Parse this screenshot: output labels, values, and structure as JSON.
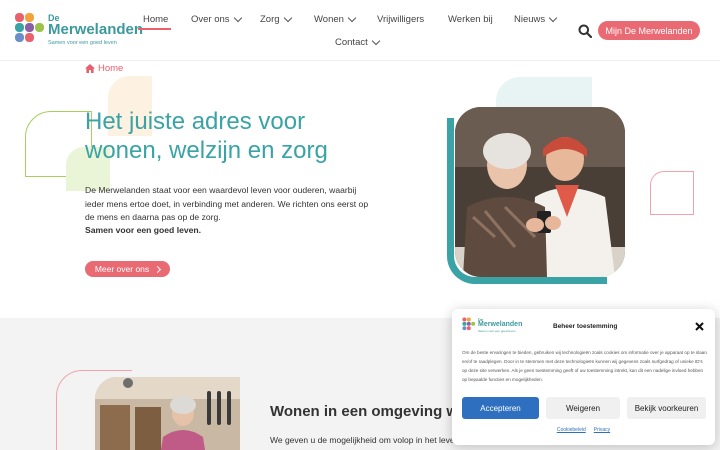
{
  "brand": {
    "name_line1": "De",
    "name_line2": "Merwelanden",
    "tagline": "Samen voor een goed leven"
  },
  "nav": {
    "items": [
      {
        "label": "Home",
        "active": true
      },
      {
        "label": "Over ons",
        "dropdown": true
      },
      {
        "label": "Zorg",
        "dropdown": true
      },
      {
        "label": "Wonen",
        "dropdown": true
      },
      {
        "label": "Vrijwilligers"
      },
      {
        "label": "Werken bij"
      },
      {
        "label": "Nieuws",
        "dropdown": true
      },
      {
        "label": "Contact",
        "dropdown": true
      }
    ],
    "cta_label": "Mijn De Merwelanden"
  },
  "hero": {
    "breadcrumb": "Home",
    "title": "Het juiste adres voor wonen, welzijn en zorg",
    "text": "De Merwelanden staat voor een waardevol leven voor ouderen, waarbij ieder mens ertoe doet, in verbinding met anderen. We richten ons eerst op de mens en daarna pas op de zorg.",
    "bold_text": "Samen voor een goed leven.",
    "button_label": "Meer over ons"
  },
  "section2": {
    "title": "Wonen in een omgeving wa",
    "text": "We geven u de mogelijkheid om volop in het leve"
  },
  "cookie": {
    "title": "Beheer toestemming",
    "body": "Om de beste ervaringen te bieden, gebruiken wij technologieën zoals cookies om informatie over je apparaat op te slaan en/of te raadplegen. Door in te stemmen met deze technologieën kunnen wij gegevens zoals surfgedrag of unieke ID's op deze site verwerken. Als je geen toestemming geeft of uw toestemming intrekt, kan dit een nadelige invloed hebben op bepaalde functies en mogelijkheden.",
    "accept_label": "Accepteren",
    "deny_label": "Weigeren",
    "prefs_label": "Bekijk voorkeuren",
    "link_cookie": "Cookiebeleid",
    "link_privacy": "Privacy"
  },
  "colors": {
    "teal": "#3aa3a5",
    "coral": "#ea6a74",
    "blue": "#2f6fc0",
    "gray_bg": "#f3f3f3"
  },
  "icons": [
    "logo-mark-icon",
    "chevron-down-icon",
    "search-icon",
    "home-icon",
    "chevron-right-icon",
    "close-icon"
  ]
}
